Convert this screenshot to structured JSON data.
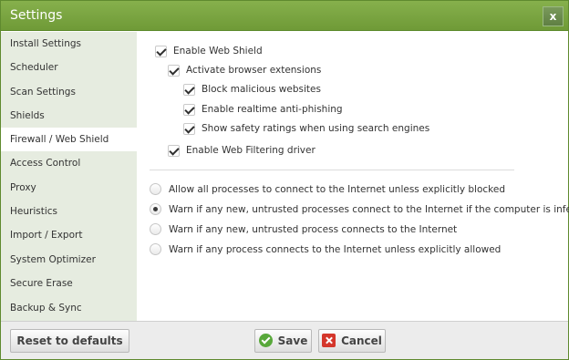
{
  "window": {
    "title": "Settings",
    "close_label": "x"
  },
  "sidebar": {
    "items": [
      {
        "label": "Install Settings"
      },
      {
        "label": "Scheduler"
      },
      {
        "label": "Scan Settings"
      },
      {
        "label": "Shields"
      },
      {
        "label": "Firewall / Web Shield",
        "active": true
      },
      {
        "label": "Access Control"
      },
      {
        "label": "Proxy"
      },
      {
        "label": "Heuristics"
      },
      {
        "label": "Import / Export"
      },
      {
        "label": "System Optimizer"
      },
      {
        "label": "Secure Erase"
      },
      {
        "label": "Backup & Sync"
      }
    ]
  },
  "web_shield": {
    "enable": {
      "label": "Enable Web Shield",
      "checked": true
    },
    "browser_ext": {
      "label": "Activate browser extensions",
      "checked": true
    },
    "block_malicious": {
      "label": "Block malicious websites",
      "checked": true
    },
    "anti_phishing": {
      "label": "Enable realtime anti-phishing",
      "checked": true
    },
    "safety_ratings": {
      "label": "Show safety ratings when using search engines",
      "checked": true
    },
    "filter_driver": {
      "label": "Enable Web Filtering driver",
      "checked": true
    }
  },
  "firewall": {
    "options": [
      {
        "label": "Allow all processes to connect to the Internet unless explicitly blocked",
        "selected": false
      },
      {
        "label": "Warn if any new, untrusted processes connect to the Internet if the computer is infected",
        "selected": true
      },
      {
        "label": "Warn if any new, untrusted process connects to the Internet",
        "selected": false
      },
      {
        "label": "Warn if any process connects to the Internet unless explicitly allowed",
        "selected": false
      }
    ]
  },
  "footer": {
    "reset_label": "Reset to defaults",
    "save_label": "Save",
    "cancel_label": "Cancel"
  }
}
